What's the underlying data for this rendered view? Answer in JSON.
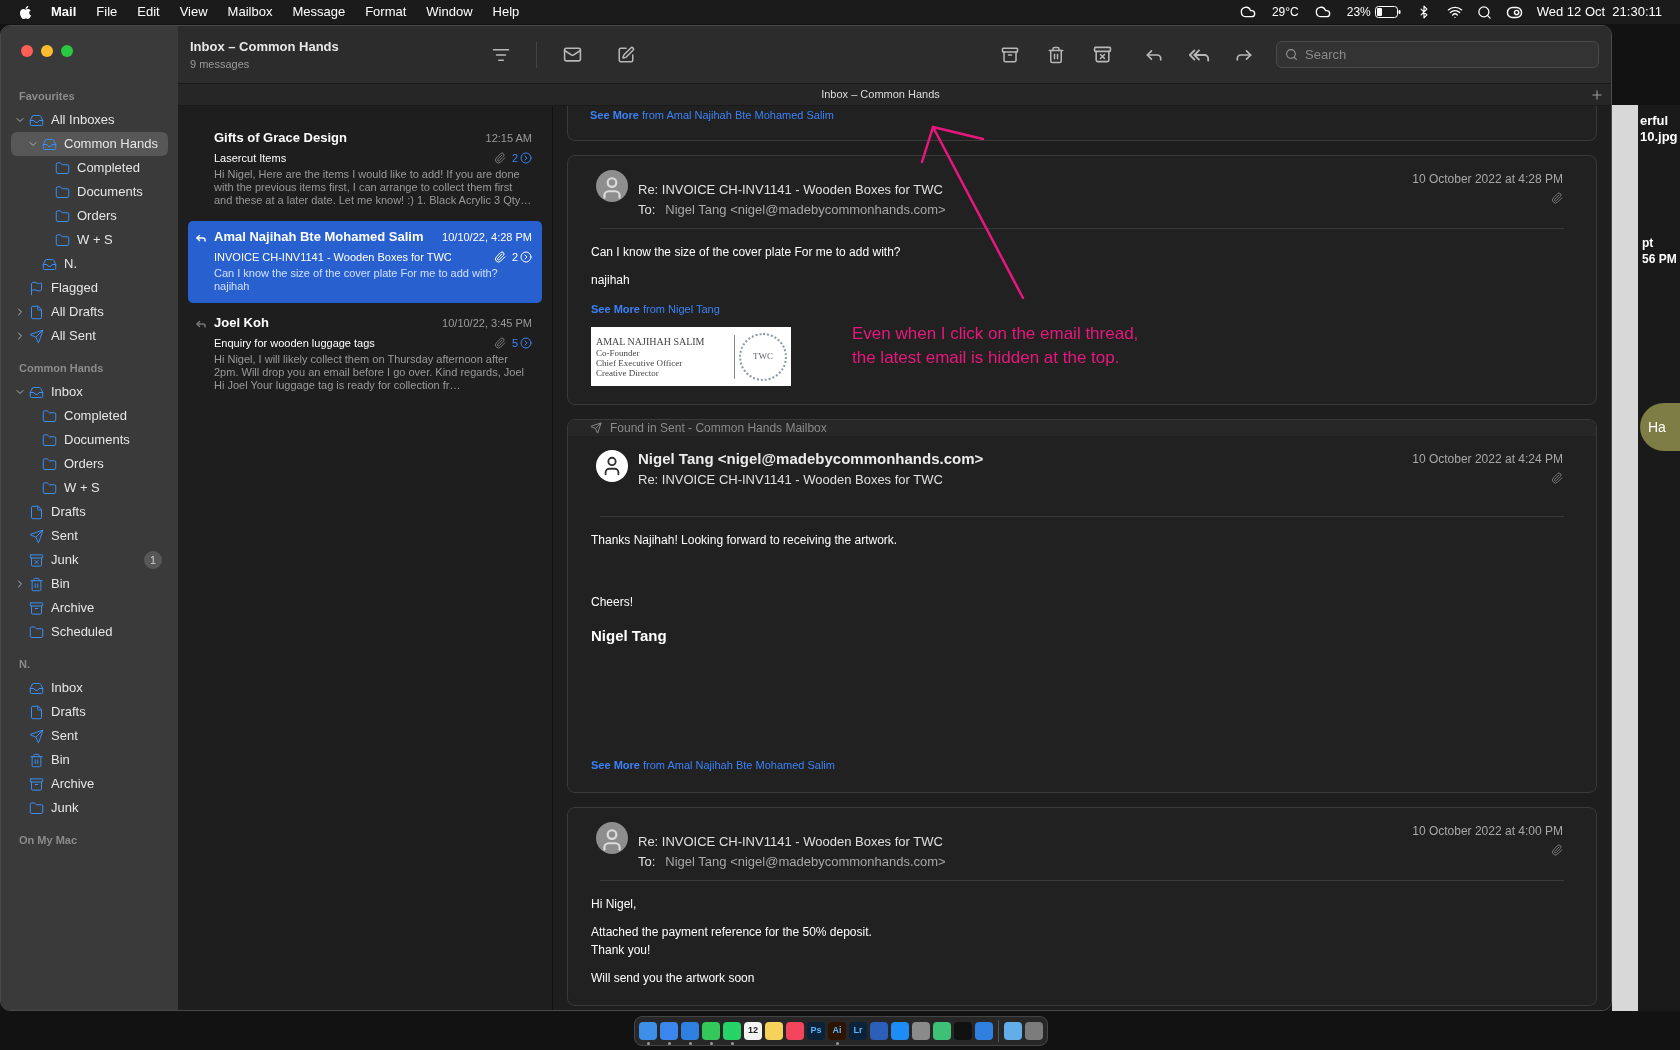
{
  "menu_bar": {
    "app": "Mail",
    "menus": [
      "File",
      "Edit",
      "View",
      "Mailbox",
      "Message",
      "Format",
      "Window",
      "Help"
    ],
    "temperature": "29°C",
    "battery": "23%",
    "clock": "Wed 12 Oct  21:30:11"
  },
  "window": {
    "title": "Inbox – Common Hands",
    "subtitle": "9 messages",
    "tab_title": "Inbox – Common Hands",
    "search": {
      "placeholder": "Search"
    }
  },
  "sidebar": {
    "sections": [
      {
        "title": "Favourites",
        "items": [
          {
            "label": "All Inboxes",
            "kind": "inbox",
            "selected": false,
            "expanded": true,
            "children": [
              {
                "label": "Common Hands",
                "kind": "inbox",
                "selected": true,
                "expanded": true,
                "children": [
                  {
                    "label": "Completed",
                    "kind": "folder",
                    "selected": false
                  },
                  {
                    "label": "Documents",
                    "kind": "folder",
                    "selected": false
                  },
                  {
                    "label": "Orders",
                    "kind": "folder",
                    "selected": false
                  },
                  {
                    "label": "W + S",
                    "kind": "folder",
                    "selected": false
                  }
                ]
              },
              {
                "label": "N.",
                "kind": "inbox",
                "selected": false
              }
            ]
          },
          {
            "label": "Flagged",
            "kind": "flag",
            "selected": false
          },
          {
            "label": "All Drafts",
            "kind": "draft",
            "selected": false,
            "expanded": false
          },
          {
            "label": "All Sent",
            "kind": "sent",
            "selected": false,
            "expanded": false
          }
        ]
      },
      {
        "title": "Common Hands",
        "items": [
          {
            "label": "Inbox",
            "kind": "inbox",
            "selected": false,
            "expanded": true,
            "children": [
              {
                "label": "Completed",
                "kind": "folder",
                "selected": false
              },
              {
                "label": "Documents",
                "kind": "folder",
                "selected": false
              },
              {
                "label": "Orders",
                "kind": "folder",
                "selected": false
              },
              {
                "label": "W + S",
                "kind": "folder",
                "selected": false
              }
            ]
          },
          {
            "label": "Drafts",
            "kind": "draft",
            "selected": false
          },
          {
            "label": "Sent",
            "kind": "sent",
            "selected": false
          },
          {
            "label": "Junk",
            "kind": "junk",
            "selected": false,
            "badge": "1"
          },
          {
            "label": "Bin",
            "kind": "bin",
            "selected": false,
            "expanded": false
          },
          {
            "label": "Archive",
            "kind": "archive",
            "selected": false
          },
          {
            "label": "Scheduled",
            "kind": "folder",
            "selected": false
          }
        ]
      },
      {
        "title": "N.",
        "items": [
          {
            "label": "Inbox",
            "kind": "inbox",
            "selected": false
          },
          {
            "label": "Drafts",
            "kind": "draft",
            "selected": false
          },
          {
            "label": "Sent",
            "kind": "sent",
            "selected": false
          },
          {
            "label": "Bin",
            "kind": "bin",
            "selected": false
          },
          {
            "label": "Archive",
            "kind": "archive",
            "selected": false
          },
          {
            "label": "Junk",
            "kind": "folder",
            "selected": false
          }
        ]
      },
      {
        "title": "On My Mac"
      }
    ]
  },
  "message_list": [
    {
      "sender": "Gifts of Grace Design",
      "time": "12:15 AM",
      "subject": "Lasercut Items",
      "attachment": true,
      "count": "2",
      "replied": false,
      "selected": false,
      "preview": "Hi Nigel, Here are the items I would like to add! If you are done with the previous items first, I can arrange to collect them first and these at a later date. Let me know! :) 1. Black Acrylic 3 Qty…"
    },
    {
      "sender": "Amal Najihah Bte Mohamed Salim",
      "time": "10/10/22, 4:28 PM",
      "subject": "INVOICE CH-INV1141 - Wooden Boxes for TWC",
      "attachment": true,
      "count": "2",
      "replied": true,
      "selected": true,
      "preview": "Can I know the size of the cover plate For me to add with? najihah"
    },
    {
      "sender": "Joel Koh",
      "time": "10/10/22, 3:45 PM",
      "subject": "Enquiry for wooden luggage tags",
      "attachment": true,
      "count": "5",
      "replied": true,
      "selected": false,
      "preview": "Hi Nigel, I will likely collect them on Thursday afternoon after 2pm. Will drop you an email before I go over. Kind regards, Joel Hi Joel Your luggage tag is ready for collection fr…"
    }
  ],
  "thread": [
    {
      "kind": "partial",
      "see_more": "See More",
      "see_more_from": "from Amal Najihah Bte Mohamed Salim"
    },
    {
      "kind": "received",
      "date": "10 October 2022 at 4:28 PM",
      "subject": "Re: INVOICE CH-INV1141 - Wooden Boxes for TWC",
      "to_label": "To:",
      "to": "Nigel Tang <nigel@madebycommonhands.com>",
      "attachment": true,
      "body": [
        "Can I know the size of the cover plate For me to add with?",
        "najihah"
      ],
      "see_more": "See More",
      "see_more_from": "from Nigel Tang",
      "signature": {
        "name": "AMAL NAJIHAH SALIM",
        "roles": [
          "Co-Founder",
          "Chief Executive Officer",
          "Creative Director"
        ],
        "logo": "TWC"
      }
    },
    {
      "kind": "sent",
      "found_in": "Found in Sent - Common Hands Mailbox",
      "from": "Nigel Tang <nigel@madebycommonhands.com>",
      "date": "10 October 2022 at 4:24 PM",
      "subject": "Re: INVOICE CH-INV1141 - Wooden Boxes for TWC",
      "attachment": true,
      "body": [
        "Thanks Najihah! Looking forward to receiving the artwork.",
        "Cheers!"
      ],
      "signoff": "Nigel Tang",
      "see_more": "See More",
      "see_more_from": "from Amal Najihah Bte Mohamed Salim"
    },
    {
      "kind": "received",
      "date": "10 October 2022 at 4:00 PM",
      "subject": "Re: INVOICE CH-INV1141 - Wooden Boxes for TWC",
      "to_label": "To:",
      "to": "Nigel Tang <nigel@madebycommonhands.com>",
      "attachment": true,
      "body": [
        "Hi Nigel,",
        "Attached the payment reference for the 50% deposit.\nThank you!",
        "Will send you the artwork soon"
      ]
    }
  ],
  "annotation": {
    "text": "Even when I click on the email thread,\nthe latest email is hidden at the top."
  },
  "background_window": {
    "title_lines": [
      "erful",
      "10.jpg"
    ],
    "time_lines": [
      "pt",
      "56 PM"
    ],
    "badge": "Ha"
  },
  "dock": [
    {
      "color": "#3d8fe8",
      "running": true,
      "separator": false
    },
    {
      "color": "#3a86ee",
      "running": true,
      "separator": false
    },
    {
      "color": "#2f7fe0",
      "running": true,
      "separator": false
    },
    {
      "color": "#34c759",
      "running": true,
      "separator": false
    },
    {
      "color": "#25d366",
      "running": true,
      "separator": false
    },
    {
      "color": "#f4f4f4",
      "running": false,
      "separator": false,
      "label": "12"
    },
    {
      "color": "#f5d25a",
      "running": false,
      "separator": false
    },
    {
      "color": "#f2455d",
      "running": false,
      "separator": false
    },
    {
      "color": "#0c2238",
      "running": false,
      "separator": false,
      "label": "Ps"
    },
    {
      "color": "#2e1300",
      "running": true,
      "separator": false,
      "label": "Ai"
    },
    {
      "color": "#0c2238",
      "running": false,
      "separator": false,
      "label": "Lr"
    },
    {
      "color": "#2b5fb8",
      "running": false,
      "separator": false
    },
    {
      "color": "#1e8cf5",
      "running": false,
      "separator": false
    },
    {
      "color": "#8a8a8a",
      "running": false,
      "separator": false
    },
    {
      "color": "#3fc077",
      "running": false,
      "separator": false
    },
    {
      "color": "#111111",
      "running": false,
      "separator": false
    },
    {
      "color": "#2f7fe0",
      "running": false,
      "separator": false
    },
    {
      "color": "#62aee8",
      "running": false,
      "separator": true
    },
    {
      "color": "#7b7b7b",
      "running": false,
      "separator": false
    }
  ]
}
